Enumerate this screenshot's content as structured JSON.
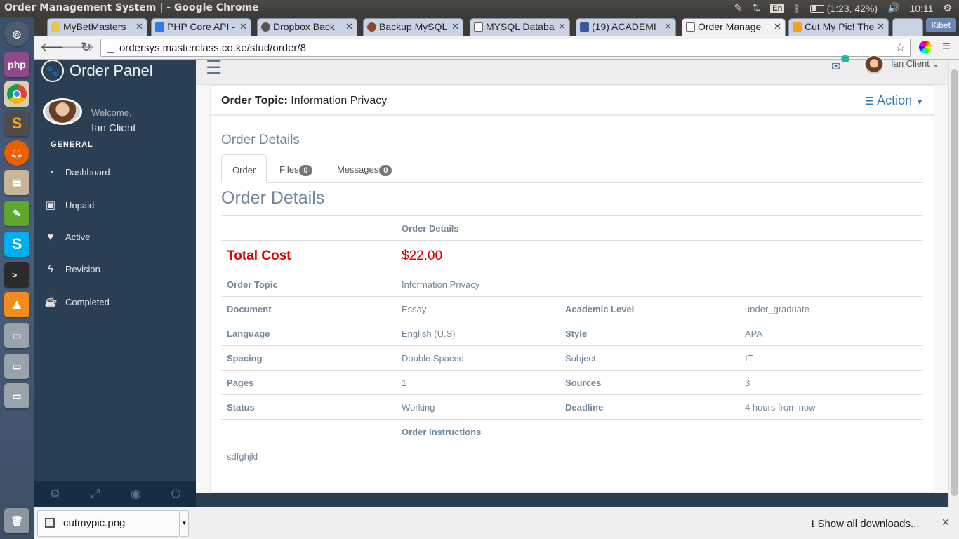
{
  "os": {
    "window_title": "Order Management System | - Google Chrome",
    "keyboard": "En",
    "battery": "(1:23, 42%)",
    "clock": "10:11"
  },
  "launcher": [
    "dash-icon",
    "php-icon",
    "chrome-icon",
    "sublime-text-icon",
    "firefox-icon",
    "files-icon",
    "text-editor-icon",
    "skype-icon",
    "terminal-icon",
    "vlc-icon",
    "drive-icon",
    "drive-icon",
    "drive-icon",
    "trash-icon"
  ],
  "browser": {
    "tabs": [
      {
        "label": "MyBetMasters",
        "active": false
      },
      {
        "label": "PHP Core API -",
        "active": false
      },
      {
        "label": "Dropbox Back",
        "active": false
      },
      {
        "label": "Backup MySQL",
        "active": false
      },
      {
        "label": "MYSQL Databa",
        "active": false
      },
      {
        "label": "(19) ACADEMI",
        "active": false
      },
      {
        "label": "Order Manage",
        "active": true
      },
      {
        "label": "Cut My Pic! The",
        "active": false
      }
    ],
    "profile": "Kibet",
    "url": "ordersys.masterclass.co.ke/stud/order/8"
  },
  "sidebar": {
    "brand": "Order Panel",
    "welcome": "Welcome,",
    "user": "Ian Client",
    "section": "GENERAL",
    "items": [
      {
        "label": "Dashboard",
        "icon": "dashboard-icon"
      },
      {
        "label": "Unpaid",
        "icon": "money-icon"
      },
      {
        "label": "Active",
        "icon": "heart-icon"
      },
      {
        "label": "Revision",
        "icon": "bolt-icon"
      },
      {
        "label": "Completed",
        "icon": "coffee-icon"
      }
    ]
  },
  "topnav": {
    "user": "Ian Client"
  },
  "panel": {
    "topic_label": "Order Topic:",
    "topic_value": "Information Privacy",
    "action": "Action",
    "heading": "Order Details",
    "tabs": [
      {
        "label": "Order",
        "count": null
      },
      {
        "label": "Files",
        "count": "0"
      },
      {
        "label": "Messages",
        "count": "0"
      }
    ],
    "subheading": "Order Details",
    "table_header": "Order Details",
    "total_label": "Total Cost",
    "total_value": "$22.00",
    "topic_row_label": "Order Topic",
    "topic_row_value": "Information Privacy",
    "rows": [
      [
        "Document",
        "Essay",
        "Academic Level",
        "under_graduate"
      ],
      [
        "Language",
        "English (U.S)",
        "Style",
        "APA"
      ],
      [
        "Spacing",
        "Double Spaced",
        "Subject",
        "IT"
      ],
      [
        "Pages",
        "1",
        "Sources",
        "3"
      ],
      [
        "Status",
        "Working",
        "Deadline",
        "4 hours from now"
      ]
    ],
    "instructions_label": "Order Instructions",
    "instructions": "sdfghjkl"
  },
  "downloads": {
    "file": "cutmypic.png",
    "show_all": "Show all downloads..."
  },
  "colors": {
    "sidebar": "#2a3f54",
    "accent": "#73879c",
    "total": "#e00000"
  }
}
